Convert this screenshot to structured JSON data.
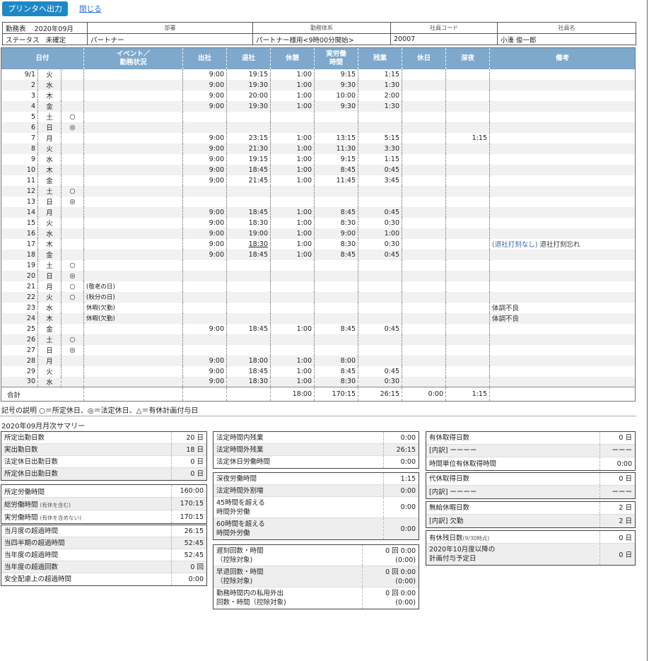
{
  "toolbar": {
    "print_label": "プリンタへ出力",
    "close_label": "閉じる"
  },
  "header": {
    "caps": {
      "dept": "部署",
      "work_system": "勤務体系",
      "emp_code": "社員コード",
      "emp_name": "社員名"
    },
    "label1": "勤務表",
    "month": "2020年09月",
    "label2": "ステータス",
    "status": "未確定",
    "dept": "パートナー",
    "work_system": "パートナー様用<9時00分開始>",
    "emp_code": "20007",
    "emp_name": "小湊 俊一郎"
  },
  "columns": [
    "日付",
    "イベント／勤務状況",
    "出社",
    "退社",
    "休憩",
    "実労働時間",
    "残業",
    "休日",
    "深夜",
    "備考"
  ],
  "rows": [
    {
      "d": "9/1",
      "w": "火",
      "m": "",
      "e": "",
      "in": "9:00",
      "out": "19:15",
      "brk": "1:00",
      "work": "9:15",
      "ot": "1:15",
      "hol": "",
      "ngt": "",
      "note": ""
    },
    {
      "d": "2",
      "w": "水",
      "m": "",
      "e": "",
      "in": "9:00",
      "out": "19:30",
      "brk": "1:00",
      "work": "9:30",
      "ot": "1:30",
      "hol": "",
      "ngt": "",
      "note": ""
    },
    {
      "d": "3",
      "w": "木",
      "m": "",
      "e": "",
      "in": "9:00",
      "out": "20:00",
      "brk": "1:00",
      "work": "10:00",
      "ot": "2:00",
      "hol": "",
      "ngt": "",
      "note": ""
    },
    {
      "d": "4",
      "w": "金",
      "m": "",
      "e": "",
      "in": "9:00",
      "out": "19:30",
      "brk": "1:00",
      "work": "9:30",
      "ot": "1:30",
      "hol": "",
      "ngt": "",
      "note": ""
    },
    {
      "d": "5",
      "w": "土",
      "m": "○",
      "e": "",
      "in": "",
      "out": "",
      "brk": "",
      "work": "",
      "ot": "",
      "hol": "",
      "ngt": "",
      "note": ""
    },
    {
      "d": "6",
      "w": "日",
      "m": "◎",
      "e": "",
      "in": "",
      "out": "",
      "brk": "",
      "work": "",
      "ot": "",
      "hol": "",
      "ngt": "",
      "note": ""
    },
    {
      "d": "7",
      "w": "月",
      "m": "",
      "e": "",
      "in": "9:00",
      "out": "23:15",
      "brk": "1:00",
      "work": "13:15",
      "ot": "5:15",
      "hol": "",
      "ngt": "1:15",
      "note": ""
    },
    {
      "d": "8",
      "w": "火",
      "m": "",
      "e": "",
      "in": "9:00",
      "out": "21:30",
      "brk": "1:00",
      "work": "11:30",
      "ot": "3:30",
      "hol": "",
      "ngt": "",
      "note": ""
    },
    {
      "d": "9",
      "w": "水",
      "m": "",
      "e": "",
      "in": "9:00",
      "out": "19:15",
      "brk": "1:00",
      "work": "9:15",
      "ot": "1:15",
      "hol": "",
      "ngt": "",
      "note": ""
    },
    {
      "d": "10",
      "w": "木",
      "m": "",
      "e": "",
      "in": "9:00",
      "out": "18:45",
      "brk": "1:00",
      "work": "8:45",
      "ot": "0:45",
      "hol": "",
      "ngt": "",
      "note": ""
    },
    {
      "d": "11",
      "w": "金",
      "m": "",
      "e": "",
      "in": "9:00",
      "out": "21:45",
      "brk": "1:00",
      "work": "11:45",
      "ot": "3:45",
      "hol": "",
      "ngt": "",
      "note": ""
    },
    {
      "d": "12",
      "w": "土",
      "m": "○",
      "e": "",
      "in": "",
      "out": "",
      "brk": "",
      "work": "",
      "ot": "",
      "hol": "",
      "ngt": "",
      "note": ""
    },
    {
      "d": "13",
      "w": "日",
      "m": "◎",
      "e": "",
      "in": "",
      "out": "",
      "brk": "",
      "work": "",
      "ot": "",
      "hol": "",
      "ngt": "",
      "note": ""
    },
    {
      "d": "14",
      "w": "月",
      "m": "",
      "e": "",
      "in": "9:00",
      "out": "18:45",
      "brk": "1:00",
      "work": "8:45",
      "ot": "0:45",
      "hol": "",
      "ngt": "",
      "note": ""
    },
    {
      "d": "15",
      "w": "火",
      "m": "",
      "e": "",
      "in": "9:00",
      "out": "18:30",
      "brk": "1:00",
      "work": "8:30",
      "ot": "0:30",
      "hol": "",
      "ngt": "",
      "note": ""
    },
    {
      "d": "16",
      "w": "水",
      "m": "",
      "e": "",
      "in": "9:00",
      "out": "19:00",
      "brk": "1:00",
      "work": "9:00",
      "ot": "1:00",
      "hol": "",
      "ngt": "",
      "note": ""
    },
    {
      "d": "17",
      "w": "木",
      "m": "",
      "e": "",
      "in": "9:00",
      "out": "18:30",
      "brk": "1:00",
      "work": "8:30",
      "ot": "0:30",
      "hol": "",
      "ngt": "",
      "note": "(退社打刻なし) 退社打刻忘れ"
    },
    {
      "d": "18",
      "w": "金",
      "m": "",
      "e": "",
      "in": "9:00",
      "out": "18:45",
      "brk": "1:00",
      "work": "8:45",
      "ot": "0:45",
      "hol": "",
      "ngt": "",
      "note": ""
    },
    {
      "d": "19",
      "w": "土",
      "m": "○",
      "e": "",
      "in": "",
      "out": "",
      "brk": "",
      "work": "",
      "ot": "",
      "hol": "",
      "ngt": "",
      "note": ""
    },
    {
      "d": "20",
      "w": "日",
      "m": "◎",
      "e": "",
      "in": "",
      "out": "",
      "brk": "",
      "work": "",
      "ot": "",
      "hol": "",
      "ngt": "",
      "note": ""
    },
    {
      "d": "21",
      "w": "月",
      "m": "○",
      "e": "(敬老の日)",
      "in": "",
      "out": "",
      "brk": "",
      "work": "",
      "ot": "",
      "hol": "",
      "ngt": "",
      "note": ""
    },
    {
      "d": "22",
      "w": "火",
      "m": "○",
      "e": "(秋分の日)",
      "in": "",
      "out": "",
      "brk": "",
      "work": "",
      "ot": "",
      "hol": "",
      "ngt": "",
      "note": ""
    },
    {
      "d": "23",
      "w": "水",
      "m": "",
      "e": "休暇(欠勤)",
      "in": "",
      "out": "",
      "brk": "",
      "work": "",
      "ot": "",
      "hol": "",
      "ngt": "",
      "note": "体調不良"
    },
    {
      "d": "24",
      "w": "木",
      "m": "",
      "e": "休暇(欠勤)",
      "in": "",
      "out": "",
      "brk": "",
      "work": "",
      "ot": "",
      "hol": "",
      "ngt": "",
      "note": "体調不良"
    },
    {
      "d": "25",
      "w": "金",
      "m": "",
      "e": "",
      "in": "9:00",
      "out": "18:45",
      "brk": "1:00",
      "work": "8:45",
      "ot": "0:45",
      "hol": "",
      "ngt": "",
      "note": ""
    },
    {
      "d": "26",
      "w": "土",
      "m": "○",
      "e": "",
      "in": "",
      "out": "",
      "brk": "",
      "work": "",
      "ot": "",
      "hol": "",
      "ngt": "",
      "note": ""
    },
    {
      "d": "27",
      "w": "日",
      "m": "◎",
      "e": "",
      "in": "",
      "out": "",
      "brk": "",
      "work": "",
      "ot": "",
      "hol": "",
      "ngt": "",
      "note": ""
    },
    {
      "d": "28",
      "w": "月",
      "m": "",
      "e": "",
      "in": "9:00",
      "out": "18:00",
      "brk": "1:00",
      "work": "8:00",
      "ot": "",
      "hol": "",
      "ngt": "",
      "note": ""
    },
    {
      "d": "29",
      "w": "火",
      "m": "",
      "e": "",
      "in": "9:00",
      "out": "18:45",
      "brk": "1:00",
      "work": "8:45",
      "ot": "0:45",
      "hol": "",
      "ngt": "",
      "note": ""
    },
    {
      "d": "30",
      "w": "水",
      "m": "",
      "e": "",
      "in": "9:00",
      "out": "18:30",
      "brk": "1:00",
      "work": "8:30",
      "ot": "0:30",
      "hol": "",
      "ngt": "",
      "note": ""
    }
  ],
  "total": {
    "label": "合計",
    "brk": "18:00",
    "work": "170:15",
    "ot": "26:15",
    "hol": "0:00",
    "ngt": "1:15"
  },
  "legend": "記号の説明 ○＝所定休日、◎＝法定休日、△＝有休計画付与日",
  "summary_title": "2020年09月月次サマリー",
  "col1": {
    "days": [
      [
        "所定出勤日数",
        "20 日"
      ],
      [
        "実出勤日数",
        "18 日"
      ],
      [
        "法定休日出勤日数",
        "0 日"
      ],
      [
        "所定休日出勤日数",
        "0 日"
      ]
    ],
    "hours": [
      [
        "所定労働時間",
        "",
        "160:00"
      ],
      [
        "総労働時間",
        "(有休を含む)",
        "170:15"
      ],
      [
        "実労働時間",
        "(有休を含めない)",
        "170:15"
      ]
    ],
    "excess": [
      [
        "当月度の超過時間",
        "26:15"
      ],
      [
        "当四半期の超過時間",
        "52:45"
      ],
      [
        "当年度の超過時間",
        "52:45"
      ],
      [
        "当年度の超過回数",
        "0 回"
      ],
      [
        "安全配慮上の超過時間",
        "0:00"
      ]
    ]
  },
  "col2": {
    "ot": [
      [
        "法定時間内残業",
        "0:00"
      ],
      [
        "法定時間外残業",
        "26:15"
      ],
      [
        "法定休日労働時間",
        "0:00"
      ]
    ],
    "night": [
      [
        "深夜労働時間",
        "1:15"
      ],
      [
        "法定時間外割増",
        "0:00"
      ],
      [
        "45時間を超える\n時間外労働",
        "0:00"
      ],
      [
        "60時間を超える\n時間外労働",
        "0:00"
      ]
    ],
    "late": [
      [
        "遅刻回数・時間\n（控除対象)",
        "0 回 0:00\n(0:00)"
      ],
      [
        "早退回数・時間\n（控除対象)",
        "0 回 0:00\n(0:00)"
      ],
      [
        "勤務時間内の私用外出\n回数・時間（控除対象)",
        "0 回 0:00\n(0:00)"
      ]
    ]
  },
  "col3": {
    "paid": [
      [
        "有休取得日数",
        "0 日"
      ],
      [
        "[内訳] ーーーー",
        "ーーー"
      ],
      [
        "時間単位有休取得時間",
        "0:00"
      ]
    ],
    "sub": [
      [
        "代休取得日数",
        "0 日"
      ],
      [
        "[内訳] ーーーー",
        "ーーー"
      ]
    ],
    "unpaid": [
      [
        "無給休暇日数",
        "2 日"
      ],
      [
        "[内訳] 欠勤",
        "2 日"
      ]
    ],
    "remain_label": "有休残日数",
    "remain_note": "(9/30時点)",
    "remain_val": "0 日",
    "plan_label": "2020年10月度以降の\n計画付与予定日",
    "plan_val": "0 日"
  }
}
